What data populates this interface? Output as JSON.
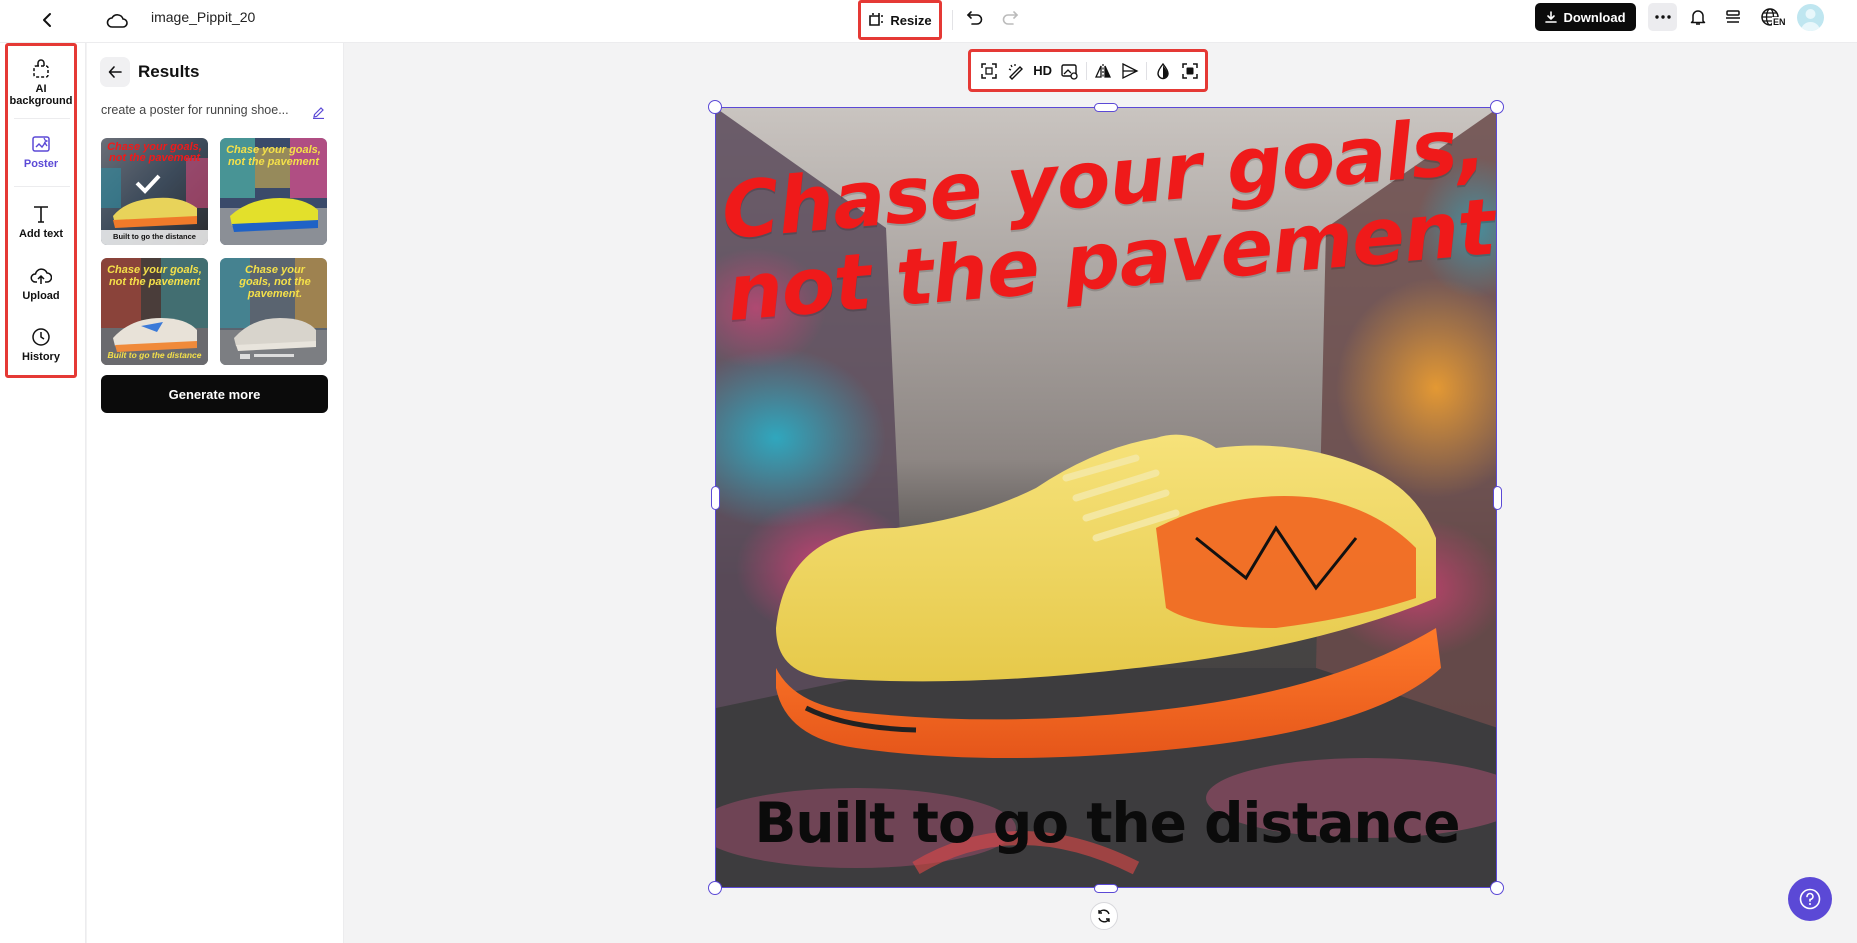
{
  "topbar": {
    "title": "image_Pippit_20",
    "resize_label": "Resize",
    "download_label": "Download",
    "lang_code": "EN"
  },
  "leftnav": {
    "items": [
      {
        "label": "AI background",
        "icon": "bag-icon"
      },
      {
        "label": "Poster",
        "icon": "poster-icon"
      },
      {
        "label": "Add text",
        "icon": "text-icon"
      },
      {
        "label": "Upload",
        "icon": "cloud-upload-icon"
      },
      {
        "label": "History",
        "icon": "clock-icon"
      }
    ]
  },
  "panel": {
    "title": "Results",
    "prompt": "create a poster for running shoe...",
    "generate_more": "Generate more",
    "thumbnails": [
      {
        "headline": "Chase your goals, not the pavement",
        "sub": "Built to go the distance",
        "selected": true
      },
      {
        "headline": "Chase your goals, not the pavement",
        "sub": ""
      },
      {
        "headline": "Chase your goals, not the pavement",
        "sub": "Built to go the distance"
      },
      {
        "headline": "Chase your goals, not the pavement.",
        "sub": ""
      }
    ]
  },
  "image_toolbar": {
    "hd_label": "HD",
    "tools": [
      "expand-icon",
      "magic-eraser-icon",
      "hd-icon",
      "image-replace-icon",
      "flip-icon",
      "align-icon",
      "opacity-icon",
      "cutout-icon"
    ]
  },
  "poster": {
    "headline_line1": "Chase your goals,",
    "headline_line2": "not the pavement",
    "tagline": "Built to go the distance"
  },
  "colors": {
    "accent": "#5b49d6",
    "highlight": "#e53935",
    "headline": "#ef1a1a"
  }
}
